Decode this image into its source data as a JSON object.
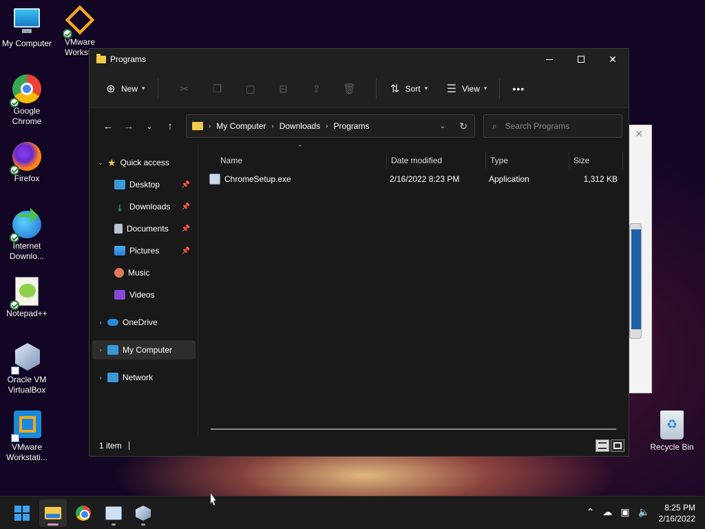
{
  "desktop": {
    "icons": [
      {
        "label": "My Computer"
      },
      {
        "label": "VMware Workstation"
      },
      {
        "label": "Google Chrome"
      },
      {
        "label": "Firefox"
      },
      {
        "label": "Internet Downlo..."
      },
      {
        "label": "Notepad++"
      },
      {
        "label": "Oracle VM VirtualBox"
      },
      {
        "label": "VMware Workstati..."
      }
    ],
    "vmware_top_label_line1": "VMware",
    "vmware_top_label_line2": "Worksta",
    "recycle_bin": "Recycle Bin"
  },
  "window": {
    "title": "Programs",
    "commands": {
      "new": "New",
      "sort": "Sort",
      "view": "View",
      "more": "•••"
    },
    "breadcrumb": [
      "My Computer",
      "Downloads",
      "Programs"
    ],
    "search_placeholder": "Search Programs"
  },
  "nav": {
    "quick_access": "Quick access",
    "items": [
      "Desktop",
      "Downloads",
      "Documents",
      "Pictures",
      "Music",
      "Videos"
    ],
    "onedrive": "OneDrive",
    "my_computer": "My Computer",
    "network": "Network"
  },
  "columns": {
    "name": "Name",
    "date": "Date modified",
    "type": "Type",
    "size": "Size"
  },
  "files": [
    {
      "name": "ChromeSetup.exe",
      "date": "2/16/2022 8:23 PM",
      "type": "Application",
      "size": "1,312 KB"
    }
  ],
  "status": {
    "count": "1 item"
  },
  "taskbar": {
    "time": "8:25 PM",
    "date": "2/16/2022"
  },
  "colors": {
    "accent": "#3aa0f0",
    "folder": "#f2c94c",
    "window_bg": "#191919"
  },
  "icons": [
    "plus-circle-icon",
    "scissors-icon",
    "copy-icon",
    "paste-icon",
    "rename-icon",
    "share-icon",
    "trash-icon",
    "sort-icon",
    "view-icon",
    "back-icon",
    "forward-icon",
    "up-icon",
    "refresh-icon",
    "search-icon",
    "star-icon",
    "pin-icon"
  ]
}
